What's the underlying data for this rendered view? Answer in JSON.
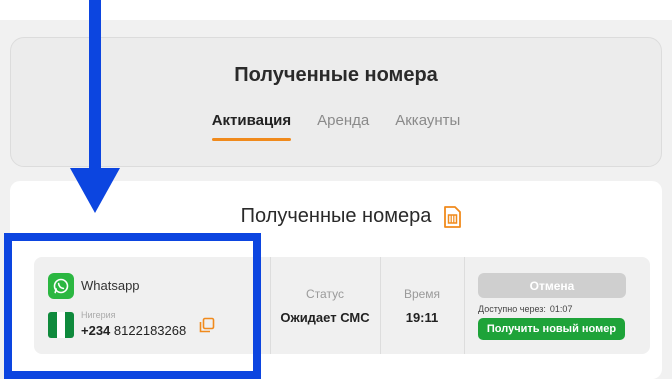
{
  "header": {
    "title": "Полученные номера",
    "tabs": [
      {
        "label": "Активация",
        "active": true
      },
      {
        "label": "Аренда",
        "active": false
      },
      {
        "label": "Аккаунты",
        "active": false
      }
    ]
  },
  "main": {
    "title": "Полученные номера",
    "title_icon": "sim-card-icon"
  },
  "order": {
    "service": "Whatsapp",
    "service_icon": "whatsapp-icon",
    "country": "Нигерия",
    "phone_code": "+234",
    "phone_number": "8122183268",
    "status_label": "Статус",
    "status_value": "Ожидает СМС",
    "time_label": "Время",
    "time_value": "19:11",
    "cancel_label": "Отмена",
    "available_label": "Доступно через:",
    "available_time": "01:07",
    "new_number_label": "Получить новый номер"
  },
  "colors": {
    "accent": "#f08a1c",
    "highlight": "#0c45e0",
    "whatsapp": "#2bb741",
    "success": "#1ea339",
    "disabled": "#cfcfcf"
  }
}
